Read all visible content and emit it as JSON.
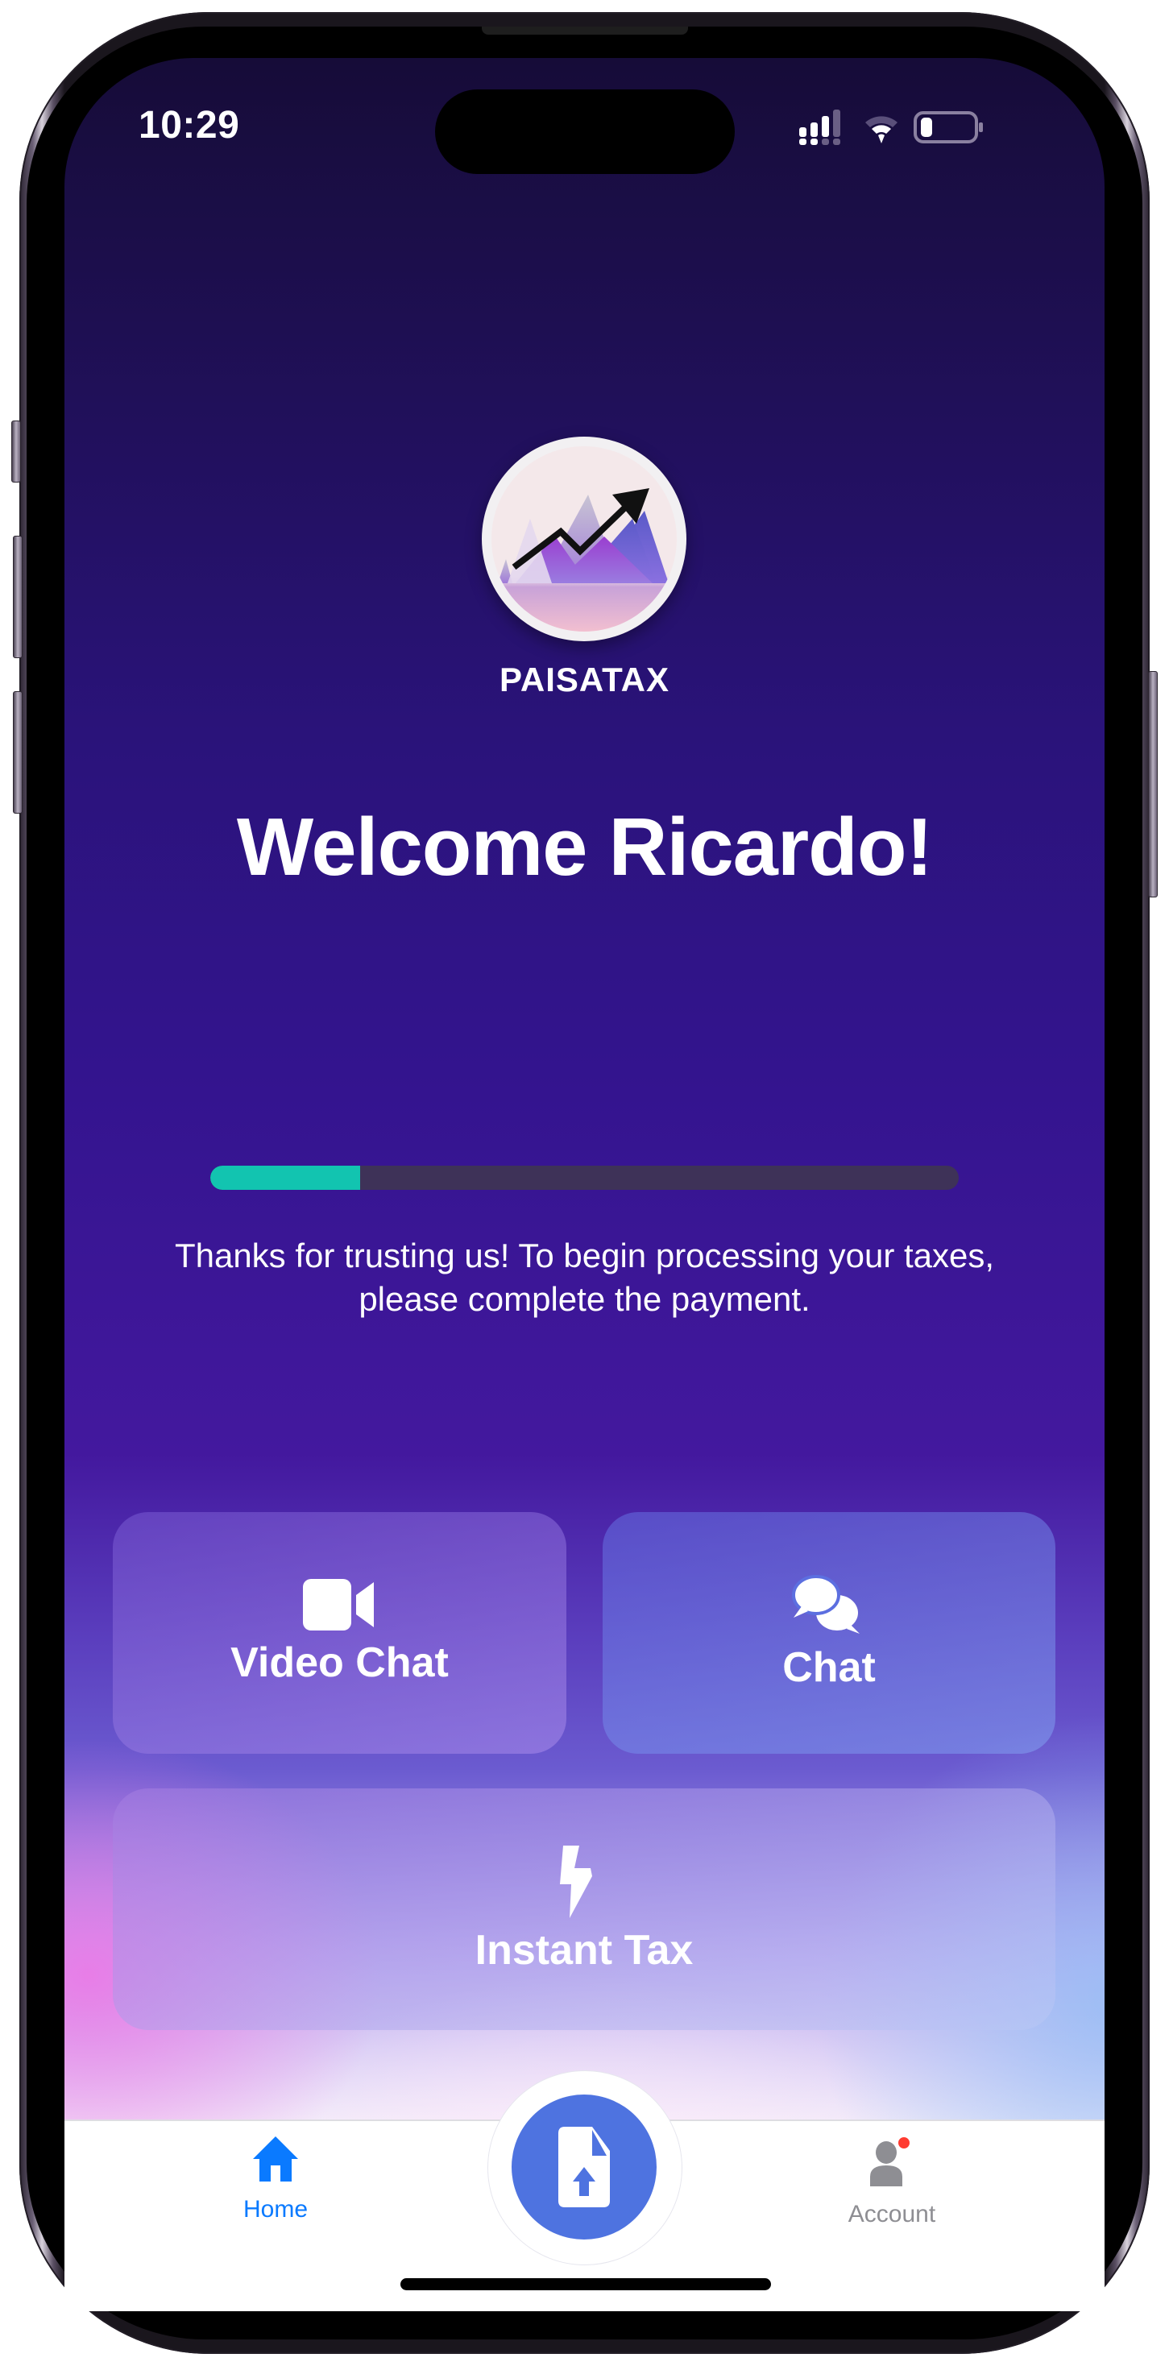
{
  "status_bar": {
    "time": "10:29",
    "icons": [
      "cellular-signal-icon",
      "wifi-icon",
      "battery-icon"
    ]
  },
  "app": {
    "brand": "PAISATAX",
    "logo": "paisatax-logo-mountains-arrow"
  },
  "welcome": {
    "title": "Welcome Ricardo!"
  },
  "progress": {
    "percent": 20,
    "fill_color": "#12c4b0",
    "track_color": "#3e3258"
  },
  "message": "Thanks for trusting us! To begin processing your taxes, please complete the payment.",
  "actions": [
    {
      "id": "video-chat",
      "label": "Video Chat",
      "icon": "video-camera-icon"
    },
    {
      "id": "chat",
      "label": "Chat",
      "icon": "chat-bubbles-icon"
    },
    {
      "id": "instant-tax",
      "label": "Instant Tax",
      "icon": "lightning-bolt-icon"
    }
  ],
  "tabbar": {
    "home": {
      "label": "Home",
      "icon": "house-icon",
      "color": "#0a7aff",
      "active": true
    },
    "upload": {
      "icon": "document-upload-icon",
      "color": "#4e73e0"
    },
    "account": {
      "label": "Account",
      "icon": "person-icon",
      "color": "#8e8e93",
      "badge": true,
      "badge_color": "#ff3b30"
    }
  }
}
